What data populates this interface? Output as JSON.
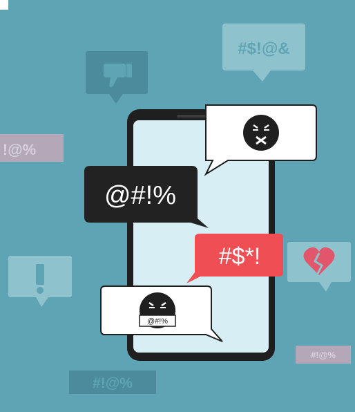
{
  "illustration": {
    "background_color": "#5ea4b5",
    "bg_bubbles": {
      "top_right_text": "#$!@&",
      "left_text": "!@%",
      "bottom_left_text": "#!@%",
      "bottom_right_text": "#!@%",
      "thumbs_down_icon": "thumbs-down-icon",
      "exclamation_icon": "exclamation-icon",
      "broken_heart_icon": "broken-heart-icon"
    },
    "phone": {
      "screen_color": "#d6eef4",
      "frame_color": "#1f1f1f"
    },
    "bubbles": {
      "dark_text": "@#!%",
      "red_text": "#$*!",
      "censored_text": "@#!%",
      "red_color": "#f04e55",
      "dark_color": "#222222",
      "angry_face_icon": "angry-face-icon",
      "censored_face_icon": "censored-face-icon"
    }
  }
}
